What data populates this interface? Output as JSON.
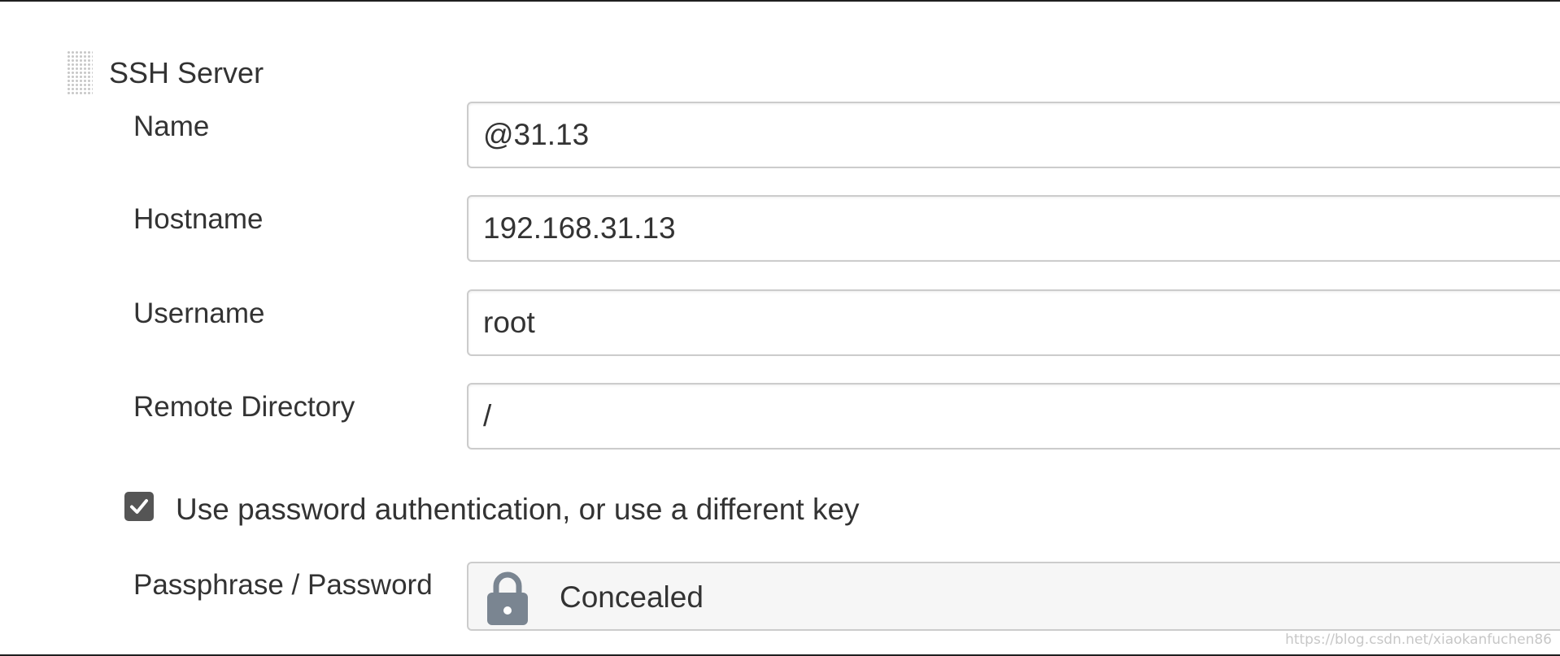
{
  "section": {
    "title": "SSH Server",
    "handle_icon": "drag-handle-icon"
  },
  "fields": {
    "name": {
      "label": "Name",
      "value": "@31.13"
    },
    "hostname": {
      "label": "Hostname",
      "value": "192.168.31.13"
    },
    "username": {
      "label": "Username",
      "value": "root"
    },
    "remote_directory": {
      "label": "Remote Directory",
      "value": "/"
    }
  },
  "password_auth": {
    "label": "Use password authentication, or use a different key",
    "checked": true,
    "check_icon": "checkmark-icon"
  },
  "passphrase": {
    "label": "Passphrase / Password",
    "value": "Concealed",
    "icon": "lock-icon"
  },
  "watermark": "https://blog.csdn.net/xiaokanfuchen86",
  "colors": {
    "checkbox": "#555555",
    "lock": "#7a8591",
    "concealed_bg": "#f6f6f6",
    "border": "#cccccc"
  }
}
